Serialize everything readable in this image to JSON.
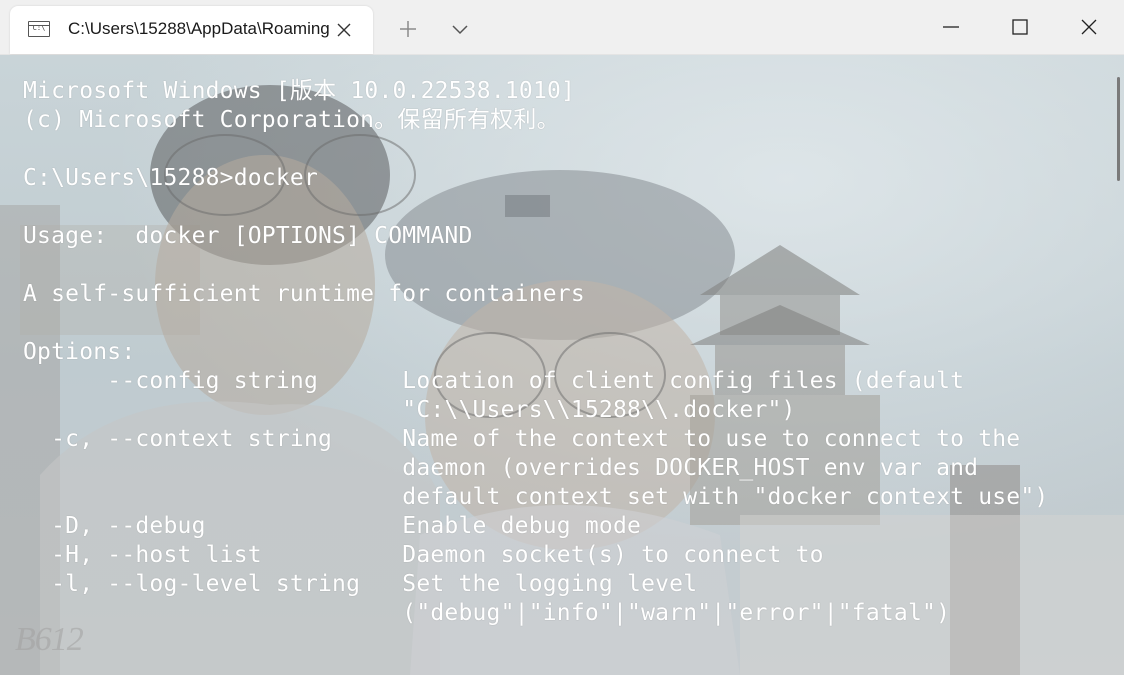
{
  "tab": {
    "title": "C:\\Users\\15288\\AppData\\Roaming",
    "icon": "cmd-icon",
    "icon_text": "C:\\"
  },
  "controls": {
    "new_tab_icon": "plus-icon",
    "dropdown_icon": "chevron-down-icon",
    "minimize_icon": "minimize-icon",
    "maximize_icon": "maximize-icon",
    "close_icon": "close-icon"
  },
  "terminal": {
    "lines": [
      "Microsoft Windows [版本 10.0.22538.1010]",
      "(c) Microsoft Corporation。保留所有权利。",
      "",
      "C:\\Users\\15288>docker",
      "",
      "Usage:  docker [OPTIONS] COMMAND",
      "",
      "A self-sufficient runtime for containers",
      "",
      "Options:",
      "      --config string      Location of client config files (default",
      "                           \"C:\\\\Users\\\\15288\\\\.docker\")",
      "  -c, --context string     Name of the context to use to connect to the",
      "                           daemon (overrides DOCKER_HOST env var and",
      "                           default context set with \"docker context use\")",
      "  -D, --debug              Enable debug mode",
      "  -H, --host list          Daemon socket(s) to connect to",
      "  -l, --log-level string   Set the logging level",
      "                           (\"debug\"|\"info\"|\"warn\"|\"error\"|\"fatal\")"
    ],
    "text_color": "#ffffff"
  },
  "background": {
    "watermark": "B612"
  }
}
